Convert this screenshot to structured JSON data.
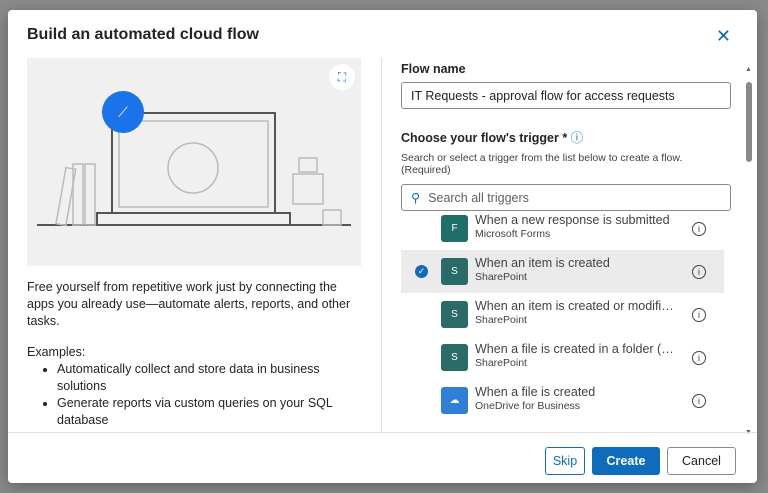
{
  "dialog": {
    "title": "Build an automated cloud flow",
    "close_icon": "close-icon"
  },
  "left": {
    "description": "Free yourself from repetitive work just by connecting the apps you already use—automate alerts, reports, and other tasks.",
    "examples_label": "Examples:",
    "examples": [
      "Automatically collect and store data in business solutions",
      "Generate reports via custom queries on your SQL database"
    ]
  },
  "form": {
    "flow_name_label": "Flow name",
    "flow_name_value": "IT Requests - approval flow for access requests",
    "trigger_label": "Choose your flow's trigger *",
    "trigger_hint": "Search or select a trigger from the list below to create a flow. (Required)",
    "search_placeholder": "Search all triggers"
  },
  "triggers": [
    {
      "name": "When a new response is submitted",
      "connector": "Microsoft Forms",
      "color": "#1f6e6a",
      "selected": false
    },
    {
      "name": "When an item is created",
      "connector": "SharePoint",
      "color": "#2a6b67",
      "selected": true
    },
    {
      "name": "When an item is created or modified",
      "connector": "SharePoint",
      "color": "#2a6b67",
      "selected": false
    },
    {
      "name": "When a file is created in a folder (de...",
      "connector": "SharePoint",
      "color": "#2a6b67",
      "selected": false
    },
    {
      "name": "When a file is created",
      "connector": "OneDrive for Business",
      "color": "#2f7fd6",
      "selected": false
    }
  ],
  "footer": {
    "skip": "Skip",
    "create": "Create",
    "cancel": "Cancel"
  },
  "colors": {
    "accent": "#0f6cbd"
  }
}
